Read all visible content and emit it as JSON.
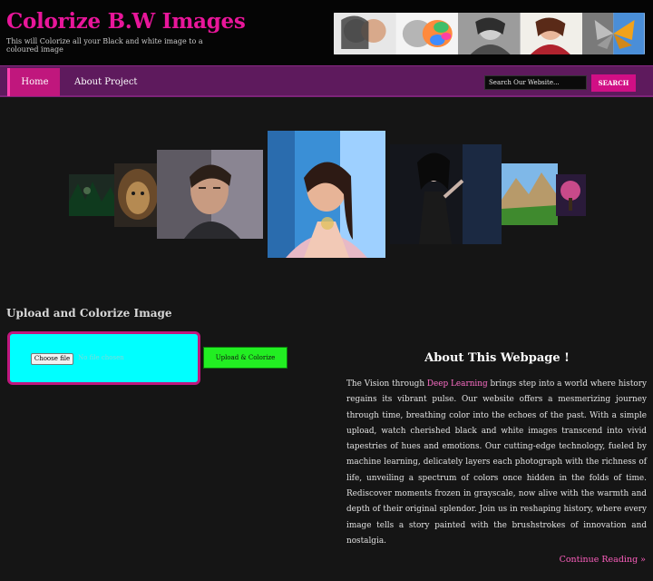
{
  "header": {
    "title": "Colorize B.W Images",
    "tagline": "This will Colorize all your Black and white image to a coloured image"
  },
  "nav": {
    "items": [
      {
        "label": "Home",
        "active": true
      },
      {
        "label": "About Project",
        "active": false
      }
    ],
    "search_placeholder": "Search Our Website...",
    "search_button": "SEARCH"
  },
  "upload": {
    "heading": "Upload and Colorize Image",
    "choose_file_label": "Choose file",
    "file_status": "No file chosen",
    "submit_label": "Upload & Colorize"
  },
  "about": {
    "title": "About This Webpage !",
    "text_intro": "The Vision through ",
    "text_highlight": "Deep Learning",
    "text_body": " brings step into a world where history regains its vibrant pulse. Our website offers a mesmerizing journey through time, breathing color into the echoes of the past. With a simple upload, watch cherished black and white images transcend into vivid tapestries of hues and emotions. Our cutting-edge technology, fueled by machine learning, delicately layers each photograph with the richness of life, unveiling a spectrum of colors once hidden in the folds of time. Rediscover moments frozen in grayscale, now alive with the warmth and depth of their original splendor. Join us in reshaping history, where every image tells a story painted with the brushstrokes of innovation and nostalgia.",
    "continue_label": "Continue Reading »"
  },
  "colors": {
    "accent_pink": "#e8169a",
    "nav_purple": "#5e1a5d",
    "upload_cyan": "#00ffff",
    "button_green": "#22ee22",
    "background": "#151515"
  }
}
